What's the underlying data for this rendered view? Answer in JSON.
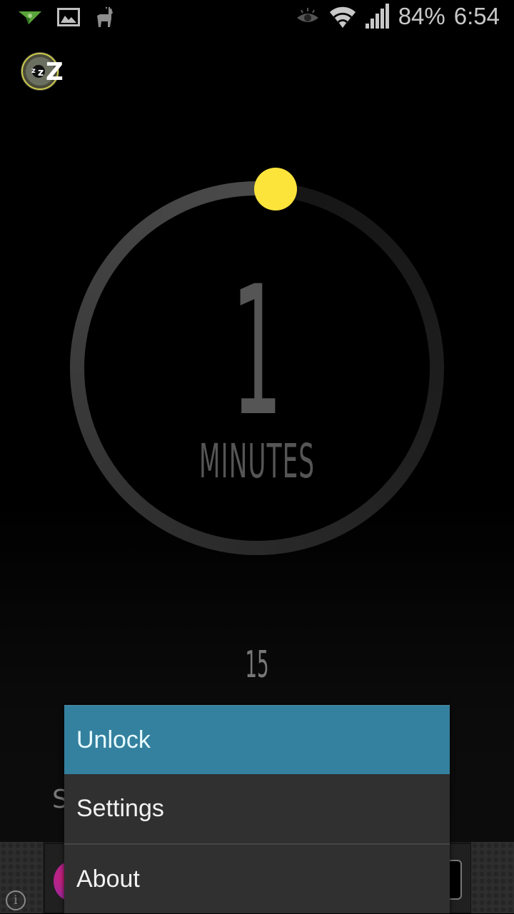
{
  "status_bar": {
    "notification_icons": [
      "paper-plane-icon",
      "image-icon",
      "llama-icon"
    ],
    "system_icons": [
      "eye-icon",
      "wifi-icon",
      "signal-icon"
    ],
    "battery": "84%",
    "time": "6:54"
  },
  "app": {
    "icon": "sleep-zzz-icon",
    "timer": {
      "value": "1",
      "unit_label": "MINUTES",
      "dial_progress": 0.0,
      "secondary_value": "15",
      "knob_color": "#fde43b"
    },
    "obscured_label": "S"
  },
  "context_menu": {
    "items": [
      {
        "label": "Unlock",
        "highlighted": true
      },
      {
        "label": "Settings",
        "highlighted": false
      },
      {
        "label": "About",
        "highlighted": false
      }
    ],
    "highlight_color": "#34809f"
  },
  "ad_banner": {
    "info_icon": "i"
  }
}
